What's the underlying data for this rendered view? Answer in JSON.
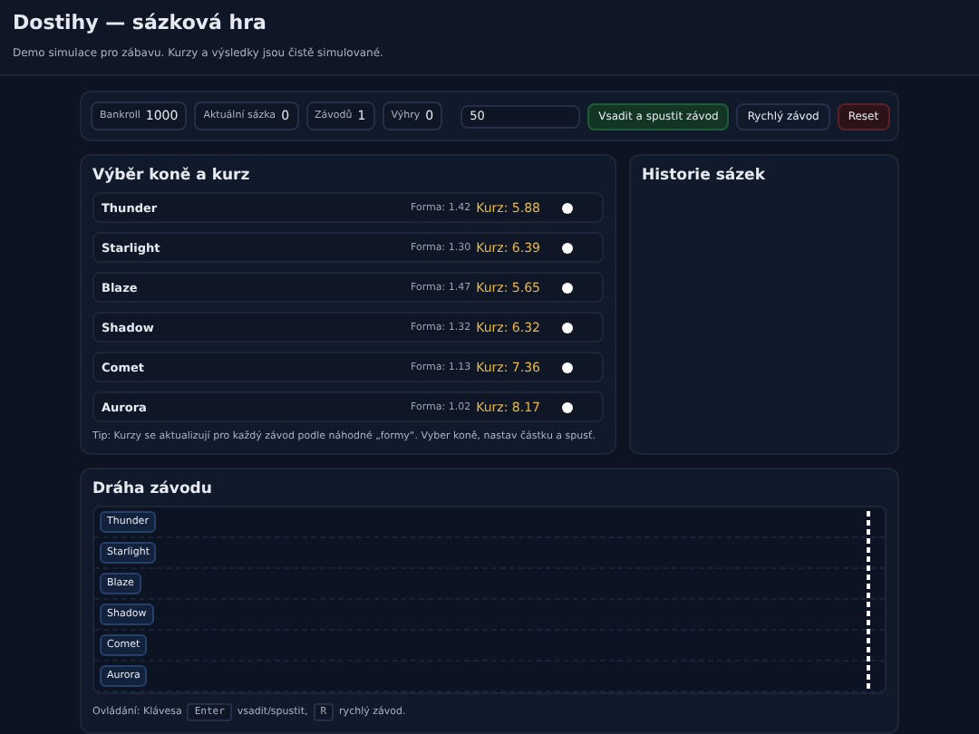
{
  "header": {
    "title": "Dostihy — sázková hra",
    "subtitle": "Demo simulace pro zábavu. Kurzy a výsledky jsou čistě simulované."
  },
  "stats": [
    {
      "label": "Bankroll",
      "value": "1000"
    },
    {
      "label": "Aktuální sázka",
      "value": "0"
    },
    {
      "label": "Závodů",
      "value": "1"
    },
    {
      "label": "Výhry",
      "value": "0"
    }
  ],
  "stake": {
    "value": "50"
  },
  "buttons": [
    {
      "label": "Vsadit a spustit závod",
      "kind": "primary"
    },
    {
      "label": "Rychlý závod",
      "kind": "plain"
    },
    {
      "label": "Reset",
      "kind": "danger"
    }
  ],
  "horse_panel": {
    "title": "Výběr koně a kurz",
    "horses": [
      {
        "name": "Thunder",
        "form": "Forma: 1.42",
        "odds": "Kurz: 5.88",
        "selected": false
      },
      {
        "name": "Starlight",
        "form": "Forma: 1.30",
        "odds": "Kurz: 6.39",
        "selected": false
      },
      {
        "name": "Blaze",
        "form": "Forma: 1.47",
        "odds": "Kurz: 5.65",
        "selected": false
      },
      {
        "name": "Shadow",
        "form": "Forma: 1.32",
        "odds": "Kurz: 6.32",
        "selected": false
      },
      {
        "name": "Comet",
        "form": "Forma: 1.13",
        "odds": "Kurz: 7.36",
        "selected": false
      },
      {
        "name": "Aurora",
        "form": "Forma: 1.02",
        "odds": "Kurz: 8.17",
        "selected": false
      }
    ],
    "tip": "Tip: Kurzy se aktualizují pro každý závod podle náhodné „formy“. Vyber koně, nastav částku a spusť."
  },
  "history_panel": {
    "title": "Historie sázek"
  },
  "track_panel": {
    "title": "Dráha závodu",
    "lanes": [
      {
        "name": "Thunder"
      },
      {
        "name": "Starlight"
      },
      {
        "name": "Blaze"
      },
      {
        "name": "Shadow"
      },
      {
        "name": "Comet"
      },
      {
        "name": "Aurora"
      }
    ],
    "controls": [
      {
        "kind": "text",
        "text": "Ovládání: Klávesa"
      },
      {
        "kind": "key",
        "text": "Enter"
      },
      {
        "kind": "text",
        "text": "vsadit/spustit,"
      },
      {
        "kind": "key",
        "text": "R"
      },
      {
        "kind": "text",
        "text": "rychlý závod."
      }
    ]
  }
}
